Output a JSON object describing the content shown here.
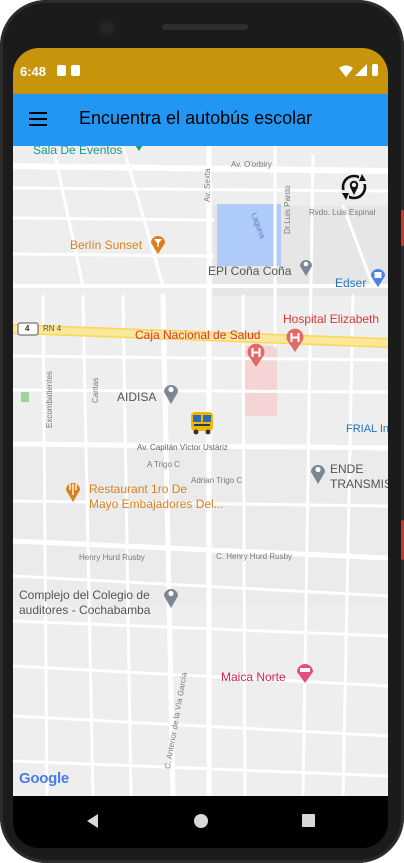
{
  "status": {
    "time": "6:48"
  },
  "appbar": {
    "title": "Encuentra el autobús escolar",
    "menu_icon": "hamburger-menu-icon"
  },
  "map": {
    "pois": {
      "sala": "Sala De Eventos",
      "berlin": "Berlín Sunset",
      "epi": "EPI Coña Coña",
      "edser": "Edser",
      "hospital": "Hospital Elizabeth",
      "caja": "Caja Nacional de Salud",
      "aidisa": "AIDISA",
      "frial": "FRIAL In",
      "ende1": "ENDE",
      "ende2": "TRANSMIS",
      "rest1": "Restaurant 1ro De",
      "rest2": "Mayo Embajadores Del...",
      "complejo1": "Complejo del Colegio de",
      "complejo2": "auditores - Cochabamba",
      "maica": "Maica Norte"
    },
    "streets": {
      "av_orbiry": "Av. O'orbiry",
      "av_sexta": "Av. Sexta",
      "laguna": "Laguna",
      "dr_luis": "Dr.Luis Pardo",
      "rvdo": "Rvdo. Luis Espinal",
      "rn4": "RN 4",
      "rn4_num": "4",
      "cantas": "Cantas",
      "excombatientes": "Excombatientes",
      "capitan": "Av. Capitán Víctor Ustáriz",
      "trigo": "A Trigo C",
      "adrian": "Adrian Trigo C",
      "henry1": "Henry Hurd Rusby",
      "henry2": "C. Henry Hurd Rusby",
      "anterior": "C. Anterior de la Vía García"
    },
    "attribution": "Google",
    "bus_icon": "school-bus-icon",
    "recenter_icon": "recenter-location-icon"
  },
  "navbar": {
    "back": "back-icon",
    "home": "home-icon",
    "recents": "recents-icon"
  },
  "colors": {
    "statusbar": "#c7950b",
    "appbar": "#2196f3",
    "map_bg": "#eeeeee",
    "highway": "#fbe79a",
    "water": "#aecbfa"
  }
}
